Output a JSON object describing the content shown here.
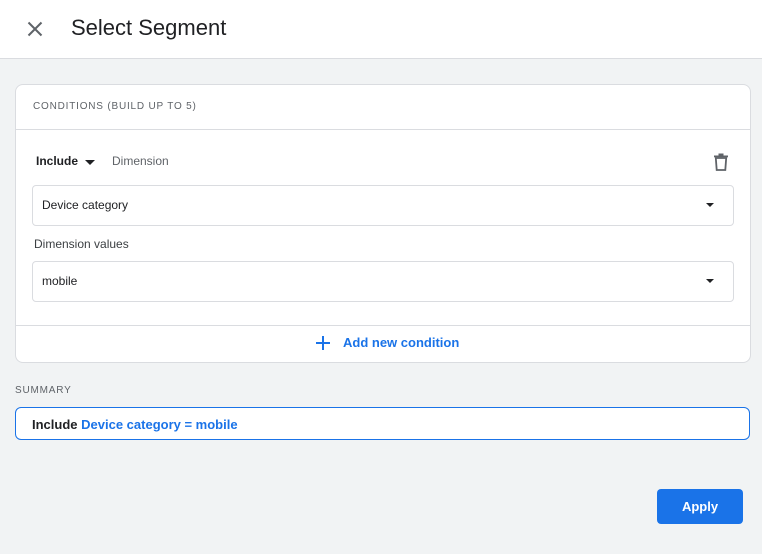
{
  "header": {
    "title": "Select Segment",
    "close_icon": "close-icon"
  },
  "conditions": {
    "heading": "CONDITIONS (BUILD UP TO 5)",
    "items": [
      {
        "mode": "Include",
        "type_label": "Dimension",
        "dimension": "Device category",
        "values_label": "Dimension values",
        "value": "mobile"
      }
    ],
    "add_label": "Add new condition"
  },
  "summary": {
    "label": "SUMMARY",
    "include": "Include",
    "condition": "Device category = mobile"
  },
  "actions": {
    "apply_label": "Apply"
  },
  "colors": {
    "accent": "#1a73e8",
    "background": "#f1f3f4",
    "border": "#dadce0"
  }
}
